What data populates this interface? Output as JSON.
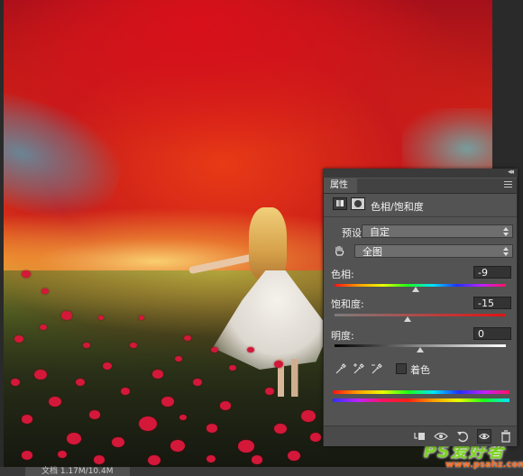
{
  "panel": {
    "tab_label": "属性",
    "collapse_glyph": "◂◂",
    "adjustment_title": "色相/饱和度",
    "preset_label": "预设:",
    "preset_value": "自定",
    "channel_value": "全图",
    "hue_label": "色相:",
    "hue_value": "-9",
    "saturation_label": "饱和度:",
    "saturation_value": "-15",
    "lightness_label": "明度:",
    "lightness_value": "0",
    "colorize_label": "着色",
    "colorize_checked": false,
    "hue_fraction": 0.475,
    "saturation_fraction": 0.425,
    "lightness_fraction": 0.5
  },
  "status": {
    "text": "文档 1.17M/10.4M"
  },
  "watermark": {
    "main": "PS爱好者",
    "sub": "www.psahz.com"
  }
}
